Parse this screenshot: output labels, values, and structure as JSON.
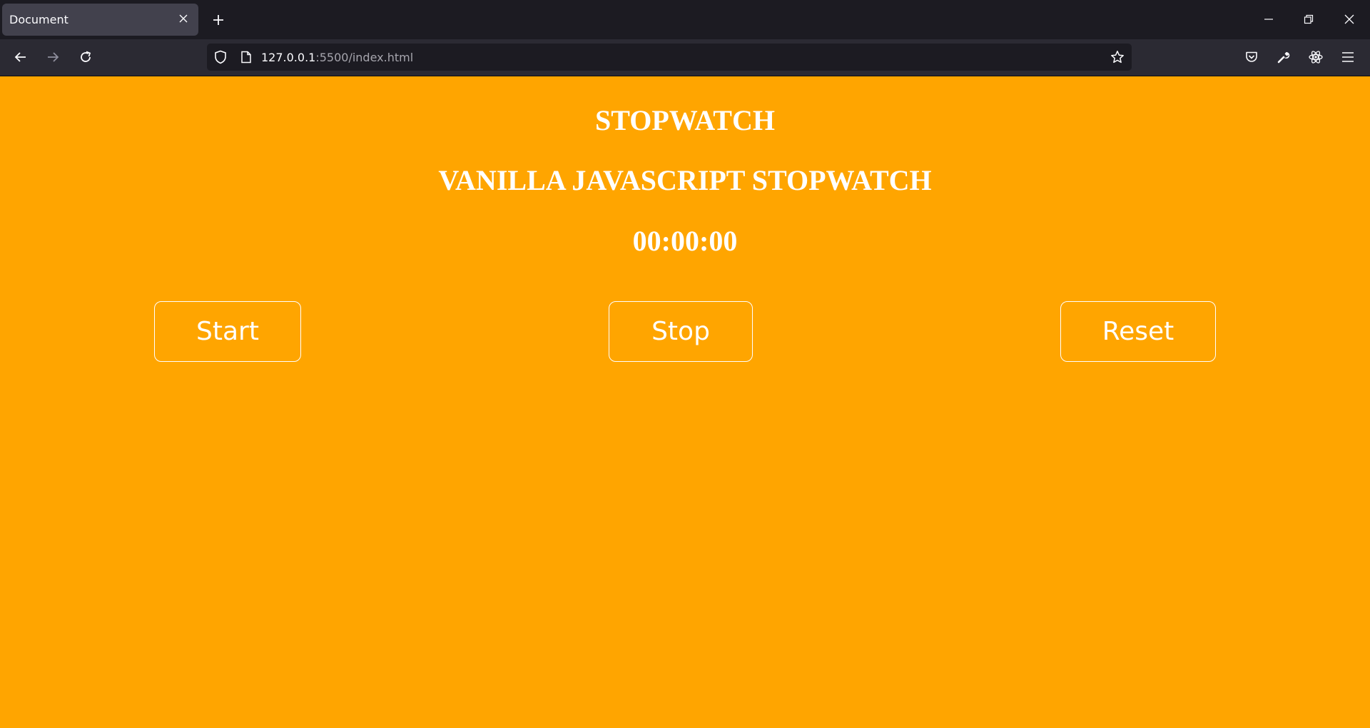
{
  "browser": {
    "tab": {
      "title": "Document"
    },
    "url": {
      "host": "127.0.0.1",
      "path": ":5500/index.html"
    }
  },
  "page": {
    "background": "#ffa500",
    "title": "STOPWATCH",
    "subtitle": "VANILLA JAVASCRIPT STOPWATCH",
    "time": "00:00:00",
    "buttons": {
      "start": "Start",
      "stop": "Stop",
      "reset": "Reset"
    }
  },
  "icons": [
    "close-icon",
    "plus-icon",
    "minimize-icon",
    "restore-icon",
    "back-icon",
    "forward-icon",
    "reload-icon",
    "shield-icon",
    "page-icon",
    "star-icon",
    "pocket-icon",
    "wrench-icon",
    "react-icon",
    "menu-icon"
  ]
}
